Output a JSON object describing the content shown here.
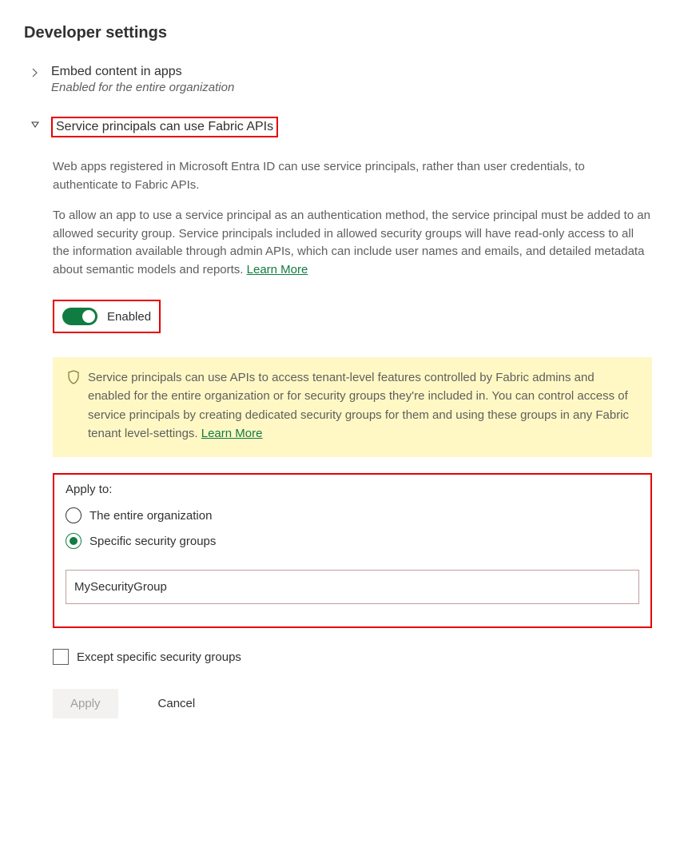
{
  "section_title": "Developer settings",
  "settings": [
    {
      "title": "Embed content in apps",
      "subtitle": "Enabled for the entire organization"
    },
    {
      "title": "Service principals can use Fabric APIs"
    }
  ],
  "description1": "Web apps registered in Microsoft Entra ID can use service principals, rather than user credentials, to authenticate to Fabric APIs.",
  "description2": "To allow an app to use a service principal as an authentication method, the service principal must be added to an allowed security group. Service principals included in allowed security groups will have read-only access to all the information available through admin APIs, which can include user names and emails, and detailed metadata about semantic models and reports.  ",
  "learn_more": "Learn More",
  "toggle_label": "Enabled",
  "info_text": "Service principals can use APIs to access tenant-level features controlled by Fabric admins and enabled for the entire organization or for security groups they're included in. You can control access of service principals by creating dedicated security groups for them and using these groups in any Fabric tenant level-settings.  ",
  "apply_to": {
    "label": "Apply to:",
    "options": [
      "The entire organization",
      "Specific security groups"
    ],
    "input_value": "MySecurityGroup"
  },
  "except_label": "Except specific security groups",
  "buttons": {
    "apply": "Apply",
    "cancel": "Cancel"
  }
}
